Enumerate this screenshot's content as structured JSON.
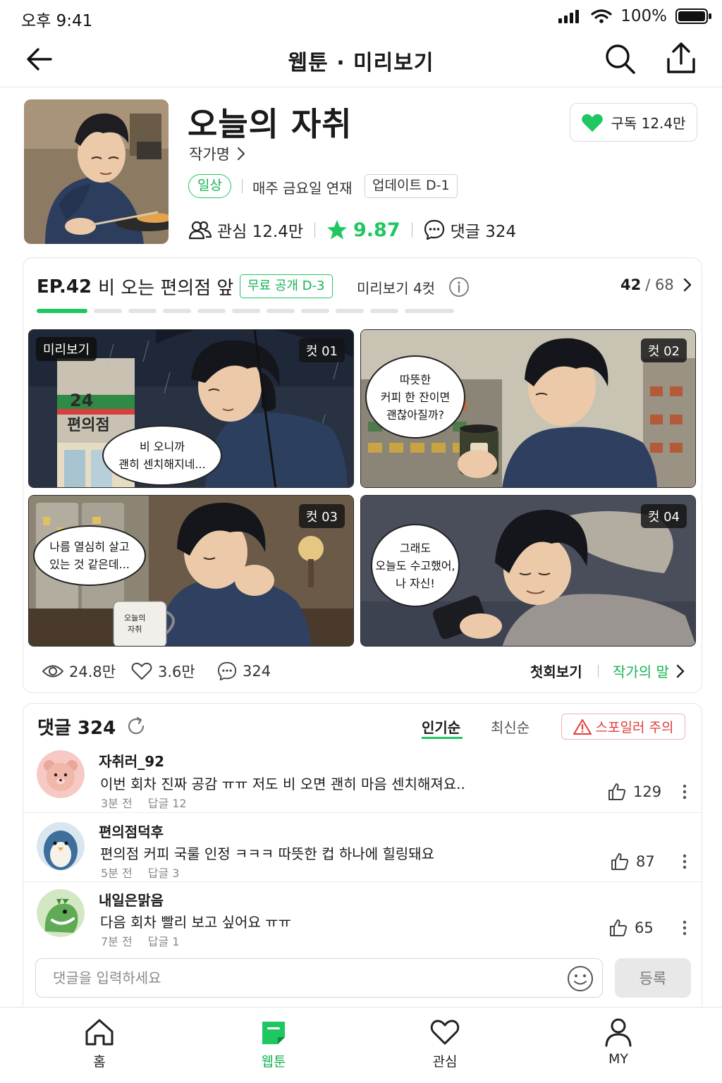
{
  "status_bar": {
    "time": "오후 9:41",
    "battery": "100%"
  },
  "nav": {
    "title": "웹툰 · 미리보기"
  },
  "series": {
    "title": "오늘의 자취",
    "author": "작가명",
    "genre": "일상",
    "schedule": "매주 금요일 연재",
    "update": "업데이트 D-1",
    "interest_label": "관심 12.4만",
    "rating": "9.87",
    "comments_label": "댓글 324",
    "subscribe_label": "구독 12.4만"
  },
  "episode": {
    "number": "EP.42",
    "title": "비 오는 편의점 앞",
    "free_tag": "무료 공개 D-3",
    "preview_count": "미리보기 4컷",
    "current": "42",
    "total": "/ 68",
    "progress_segments": 11,
    "progress_filled": 1,
    "preview_badge": "미리보기",
    "panels": [
      {
        "cut": "컷 01",
        "bubble": "비 오니까\n괜히 센치해지네...",
        "sign_number": "24",
        "sign_text": "편의점"
      },
      {
        "cut": "컷 02",
        "bubble": "따뜻한\n커피 한 잔이면\n괜찮아질까?"
      },
      {
        "cut": "컷 03",
        "bubble": "나름 열심히 살고\n있는 것 같은데...",
        "mug_text": "오늘의\n자취"
      },
      {
        "cut": "컷 04",
        "bubble": "그래도\n오늘도 수고했어,\n나 자신!"
      }
    ],
    "views": "24.8만",
    "likes": "3.6만",
    "comments": "324",
    "first_episode_link": "첫회보기",
    "author_note_link": "작가의 말"
  },
  "comments": {
    "title": "댓글 324",
    "sort_popular": "인기순",
    "sort_latest": "최신순",
    "spoiler_label": "스포일러 주의",
    "items": [
      {
        "user": "자취러_92",
        "text": "이번 회차 진짜 공감 ㅠㅠ 저도 비 오면 괜히 마음 센치해져요..",
        "time": "3분 전",
        "replies": "답글 12",
        "likes": "129",
        "avatar": "bear-avatar"
      },
      {
        "user": "편의점덕후",
        "text": "편의점 커피 국룰 인정 ㅋㅋㅋ 따뜻한 컵 하나에 힐링돼요",
        "time": "5분 전",
        "replies": "답글 3",
        "likes": "87",
        "avatar": "penguin-avatar"
      },
      {
        "user": "내일은맑음",
        "text": "다음 회차 빨리 보고 싶어요 ㅠㅠ",
        "time": "7분 전",
        "replies": "답글 1",
        "likes": "65",
        "avatar": "dinosaur-avatar"
      }
    ],
    "input_placeholder": "댓글을 입력하세요",
    "submit_label": "등록"
  },
  "tabs": [
    {
      "label": "홈",
      "icon": "home-icon"
    },
    {
      "label": "웹툰",
      "icon": "webtoon-icon",
      "active": true
    },
    {
      "label": "관심",
      "icon": "heart-icon"
    },
    {
      "label": "MY",
      "icon": "person-icon"
    }
  ],
  "colors": {
    "accent": "#1ec760",
    "accent_text": "#15b455",
    "warning": "#e23b3b"
  }
}
